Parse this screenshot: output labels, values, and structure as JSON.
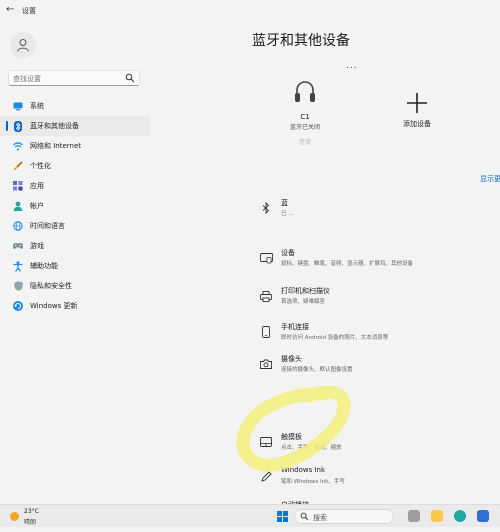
{
  "window": {
    "title": "设置"
  },
  "sidebar": {
    "search_placeholder": "查找设置",
    "items": [
      {
        "label": "系统",
        "icon": "monitor-icon"
      },
      {
        "label": "蓝牙和其他设备",
        "icon": "bluetooth-icon",
        "selected": true
      },
      {
        "label": "网络和 Internet",
        "icon": "wifi-icon"
      },
      {
        "label": "个性化",
        "icon": "brush-icon"
      },
      {
        "label": "应用",
        "icon": "apps-icon"
      },
      {
        "label": "帐户",
        "icon": "person-icon"
      },
      {
        "label": "时间和语言",
        "icon": "globe-clock-icon"
      },
      {
        "label": "游戏",
        "icon": "gamepad-icon"
      },
      {
        "label": "辅助功能",
        "icon": "accessibility-icon"
      },
      {
        "label": "隐私和安全性",
        "icon": "shield-icon"
      },
      {
        "label": "Windows 更新",
        "icon": "update-icon"
      }
    ]
  },
  "main": {
    "title": "蓝牙和其他设备",
    "more": "...",
    "device_card": {
      "name": "C1",
      "status": "蓝牙已关闭",
      "action": "连接"
    },
    "add_device_label": "添加设备",
    "show_more": "显示更",
    "rows": [
      {
        "title": "蓝",
        "desc": "已 ...",
        "icon": "bluetooth-icon"
      },
      {
        "title": "设备",
        "desc": "鼠标、键盘、触笔、音频、显示器、扩展坞、其他设备",
        "icon": "devices-icon"
      },
      {
        "title": "打印机和扫描仪",
        "desc": "首选项、疑难解答",
        "icon": "printer-icon"
      },
      {
        "title": "手机连接",
        "desc": "即时访问 Android 设备的照片、文本消息等",
        "icon": "phone-icon"
      },
      {
        "title": "摄像头",
        "desc": "连接的摄像头、默认图像设置",
        "icon": "camera-icon"
      },
      {
        "title": "触摸板",
        "desc": "点击、手势、滚动、缩放",
        "icon": "touchpad-icon"
      },
      {
        "title": "Windows Ink",
        "desc": "笔和 Windows Ink、手写",
        "icon": "pen-icon"
      },
      {
        "title": "自动播放",
        "desc": "",
        "icon": "autoplay-icon"
      }
    ]
  },
  "taskbar": {
    "weather_temp": "23°C",
    "weather_desc": "晴朗",
    "search_label": "搜索"
  },
  "colors": {
    "accent": "#0067c0",
    "highlight": "#f2ee7a",
    "window_bg": "#f3f3f3"
  }
}
